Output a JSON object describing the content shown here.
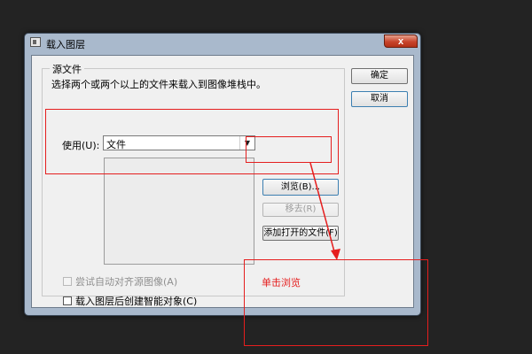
{
  "window": {
    "title": "载入图层",
    "close_glyph": "x"
  },
  "source_group": {
    "legend": "源文件",
    "description": "选择两个或两个以上的文件来载入到图像堆栈中。",
    "use_label": "使用(U):",
    "use_value": "文件"
  },
  "buttons": {
    "browse": "浏览(B)...",
    "remove": "移去(R)",
    "add_open_files": "添加打开的文件(F)",
    "ok": "确定",
    "cancel": "取消"
  },
  "checkboxes": {
    "auto_align": {
      "label": "尝试自动对齐源图像(A)",
      "checked": false,
      "enabled": false
    },
    "smart_object": {
      "label": "载入图层后创建智能对象(C)",
      "checked": false,
      "enabled": true
    }
  },
  "annotation": {
    "label": "单击浏览",
    "color": "#e51e1e"
  },
  "icons": [
    "window-app-icon",
    "close-icon",
    "chevron-down-icon",
    "annotation-arrow-icon"
  ]
}
